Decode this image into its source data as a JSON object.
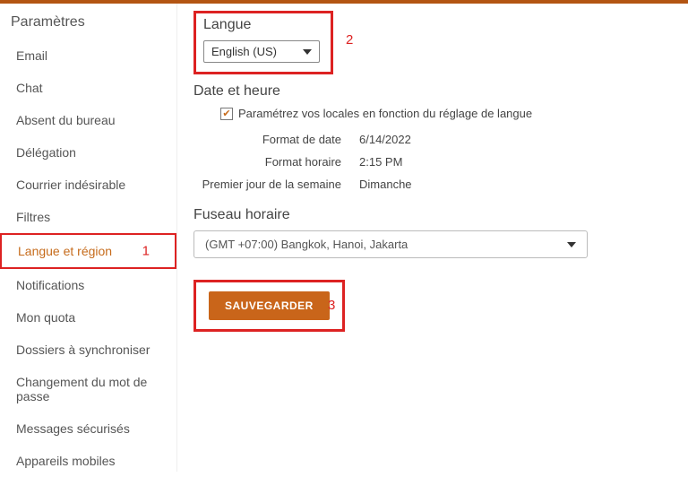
{
  "sidebar": {
    "title": "Paramètres",
    "items": [
      "Email",
      "Chat",
      "Absent du bureau",
      "Délégation",
      "Courrier indésirable",
      "Filtres",
      "Langue et région",
      "Notifications",
      "Mon quota",
      "Dossiers à synchroniser",
      "Changement du mot de passe",
      "Messages sécurisés",
      "Appareils mobiles"
    ],
    "active_index": 6
  },
  "annotations": {
    "a1": "1",
    "a2": "2",
    "a3": "3"
  },
  "language": {
    "heading": "Langue",
    "selected": "English (US)"
  },
  "datetime": {
    "heading": "Date et heure",
    "checkbox_label": "Paramétrez vos locales en fonction du réglage de langue",
    "rows": {
      "date_format_label": "Format de date",
      "date_format_value": "6/14/2022",
      "time_format_label": "Format horaire",
      "time_format_value": "2:15 PM",
      "first_day_label": "Premier jour de la semaine",
      "first_day_value": "Dimanche"
    }
  },
  "timezone": {
    "heading": "Fuseau horaire",
    "selected": "(GMT +07:00) Bangkok, Hanoi, Jakarta"
  },
  "save_label": "SAUVEGARDER"
}
